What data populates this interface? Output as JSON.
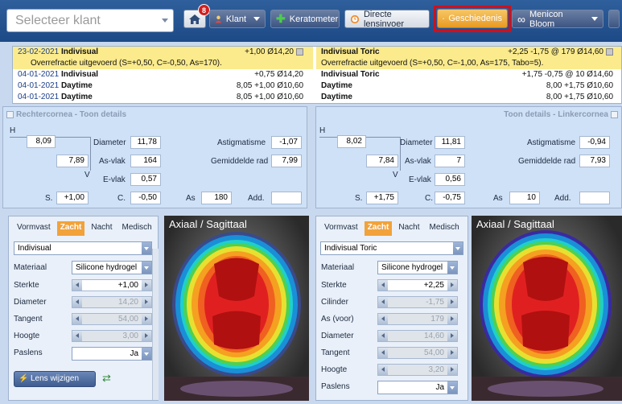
{
  "toolbar": {
    "client_placeholder": "Selecteer klant",
    "badge_count": "8",
    "klant_label": "Klant",
    "keratometer_label": "Keratometer",
    "direct_label": "Directe lensinvoer",
    "history_label": "Geschiedenis",
    "menicon_label": "Menicon Bloom"
  },
  "history": {
    "left": [
      {
        "date": "23-02-2021",
        "name": "Indivisual",
        "value": "+1,00 Ø14,20"
      },
      {
        "note": "Overrefractie uitgevoerd (S=+0,50, C=-0,50, As=170)."
      },
      {
        "date": "04-01-2021",
        "name": "Indivisual",
        "value": "+0,75 Ø14,20"
      },
      {
        "date": "04-01-2021",
        "name": "Daytime",
        "value": "8,05 +1,00 Ø10,60"
      },
      {
        "date": "04-01-2021",
        "name": "Daytime",
        "value": "8,05 +1,00 Ø10,60"
      }
    ],
    "right": [
      {
        "name": "Indivisual Toric",
        "value": "+2,25 -1,75 @ 179 Ø14,60"
      },
      {
        "note": "Overrefractie uitgevoerd (S=+0,50, C=-1,00, As=175, Tabo=5)."
      },
      {
        "name": "Indivisual Toric",
        "value": "+1,75 -0,75 @ 10 Ø14,60"
      },
      {
        "name": "Daytime",
        "value": "8,00 +1,75 Ø10,60"
      },
      {
        "name": "Daytime",
        "value": "8,00 +1,75 Ø10,60"
      }
    ]
  },
  "cornea_left": {
    "title": "Rechtercornea",
    "toon": "Toon details",
    "h": "H",
    "v": "V",
    "h_value": "8,09",
    "v_value": "7,89",
    "diameter_label": "Diameter",
    "diameter": "11,78",
    "asvlak_label": "As-vlak",
    "asvlak": "164",
    "evlak_label": "E-vlak",
    "evlak": "0,57",
    "astig_label": "Astigmatisme",
    "astig": "-1,07",
    "gemrad_label": "Gemiddelde rad",
    "gemrad": "7,99",
    "s_label": "S.",
    "s": "+1,00",
    "c_label": "C.",
    "c": "-0,50",
    "as_label": "As",
    "as": "180",
    "add_label": "Add.",
    "add": ""
  },
  "cornea_right": {
    "title": "Linkercornea",
    "toon": "Toon details",
    "h": "H",
    "v": "V",
    "h_value": "8,02",
    "v_value": "7,84",
    "diameter_label": "Diameter",
    "diameter": "11,81",
    "asvlak_label": "As-vlak",
    "asvlak": "7",
    "evlak_label": "E-vlak",
    "evlak": "0,56",
    "astig_label": "Astigmatisme",
    "astig": "-0,94",
    "gemrad_label": "Gemiddelde rad",
    "gemrad": "7,93",
    "s_label": "S.",
    "s": "+1,75",
    "c_label": "C.",
    "c": "-0,75",
    "as_label": "As",
    "as": "10",
    "add_label": "Add.",
    "add": ""
  },
  "lens_left": {
    "tabs": [
      "Vormvast",
      "Zacht",
      "Nacht",
      "Medisch"
    ],
    "active_tab": "Zacht",
    "type": "Indivisual",
    "materiaal_label": "Materiaal",
    "materiaal": "Silicone hydrogel",
    "sterkte_label": "Sterkte",
    "sterkte": "+1,00",
    "diameter_label": "Diameter",
    "diameter": "14,20",
    "tangent_label": "Tangent",
    "tangent": "54,00",
    "hoogte_label": "Hoogte",
    "hoogte": "3,00",
    "paslens_label": "Paslens",
    "paslens": "Ja",
    "lens_btn": "Lens wijzigen"
  },
  "lens_right": {
    "tabs": [
      "Vormvast",
      "Zacht",
      "Nacht",
      "Medisch"
    ],
    "active_tab": "Zacht",
    "type": "Indivisual Toric",
    "materiaal_label": "Materiaal",
    "materiaal": "Silicone hydrogel",
    "sterkte_label": "Sterkte",
    "sterkte": "+2,25",
    "cilinder_label": "Cilinder",
    "cilinder": "-1,75",
    "as_label": "As (voor)",
    "as": "179",
    "diameter_label": "Diameter",
    "diameter": "14,60",
    "tangent_label": "Tangent",
    "tangent": "54,00",
    "hoogte_label": "Hoogte",
    "hoogte": "3,20",
    "paslens_label": "Paslens",
    "paslens": "Ja"
  },
  "topo": {
    "title": "Axiaal / Sagittaal"
  },
  "colors": {
    "toolbar": "#1d4a86",
    "history_sel": "#fbeb8c",
    "accent": "#f2a23a",
    "highlight": "#d0101a"
  }
}
